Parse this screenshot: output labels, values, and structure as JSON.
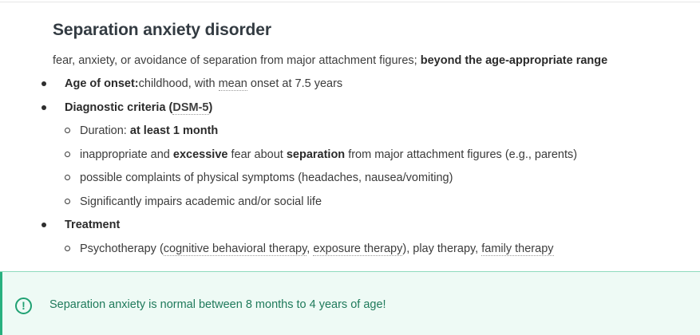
{
  "title": "Separation anxiety disorder",
  "intro": {
    "text": "fear, anxiety, or avoidance of separation from major attachment figures;",
    "bold": "beyond the age-appropriate range"
  },
  "items": [
    {
      "label": "Age of onset:",
      "text_before": "childhood, with",
      "link": "mean",
      "text_after": "onset at 7.5 years"
    },
    {
      "label": "Diagnostic criteria (",
      "link": "DSM-5",
      "label_end": ")",
      "subitems": [
        {
          "prefix": "Duration:",
          "bold": "at least 1 month"
        },
        {
          "t1": "inappropriate and",
          "b1": "excessive",
          "t2": "fear about",
          "b2": "separation",
          "t3": "from major attachment figures (e.g., parents)"
        },
        {
          "text": "possible complaints of physical symptoms (headaches, nausea/vomiting)"
        },
        {
          "text": "Significantly impairs academic and/or social life"
        }
      ]
    },
    {
      "label": "Treatment",
      "subitems": [
        {
          "t1": "Psychotherapy (",
          "link1": "cognitive behavioral therapy",
          "t2": ",",
          "link2": "exposure therapy",
          "t3": "), play therapy,",
          "link3": "family therapy"
        }
      ]
    }
  ],
  "callout": {
    "icon": "exclamation-icon",
    "icon_glyph": "!",
    "text": "Separation anxiety is normal between 8 months to 4 years of age!",
    "accent": "#28b07f",
    "background": "#eefaf5"
  }
}
